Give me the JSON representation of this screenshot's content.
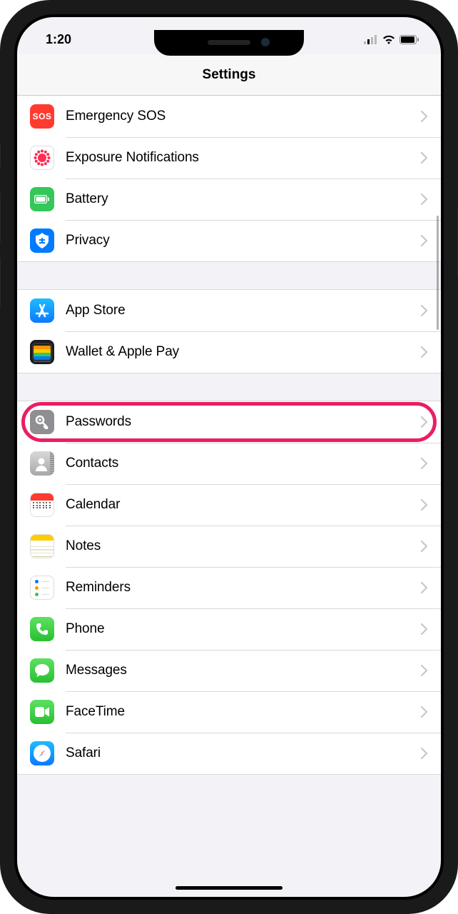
{
  "status": {
    "time": "1:20"
  },
  "header": {
    "title": "Settings"
  },
  "groups": [
    {
      "rows": [
        {
          "id": "emergency-sos",
          "label": "Emergency SOS",
          "icon": "sos"
        },
        {
          "id": "exposure-notifications",
          "label": "Exposure Notifications",
          "icon": "exposure"
        },
        {
          "id": "battery",
          "label": "Battery",
          "icon": "battery"
        },
        {
          "id": "privacy",
          "label": "Privacy",
          "icon": "privacy"
        }
      ]
    },
    {
      "rows": [
        {
          "id": "app-store",
          "label": "App Store",
          "icon": "appstore"
        },
        {
          "id": "wallet-apple-pay",
          "label": "Wallet & Apple Pay",
          "icon": "wallet"
        }
      ]
    },
    {
      "rows": [
        {
          "id": "passwords",
          "label": "Passwords",
          "icon": "passwords",
          "highlighted": true
        },
        {
          "id": "contacts",
          "label": "Contacts",
          "icon": "contacts"
        },
        {
          "id": "calendar",
          "label": "Calendar",
          "icon": "calendar"
        },
        {
          "id": "notes",
          "label": "Notes",
          "icon": "notes"
        },
        {
          "id": "reminders",
          "label": "Reminders",
          "icon": "reminders"
        },
        {
          "id": "phone",
          "label": "Phone",
          "icon": "phone"
        },
        {
          "id": "messages",
          "label": "Messages",
          "icon": "messages"
        },
        {
          "id": "facetime",
          "label": "FaceTime",
          "icon": "facetime"
        },
        {
          "id": "safari",
          "label": "Safari",
          "icon": "safari"
        }
      ]
    }
  ],
  "colors": {
    "highlight": "#e91e63"
  }
}
